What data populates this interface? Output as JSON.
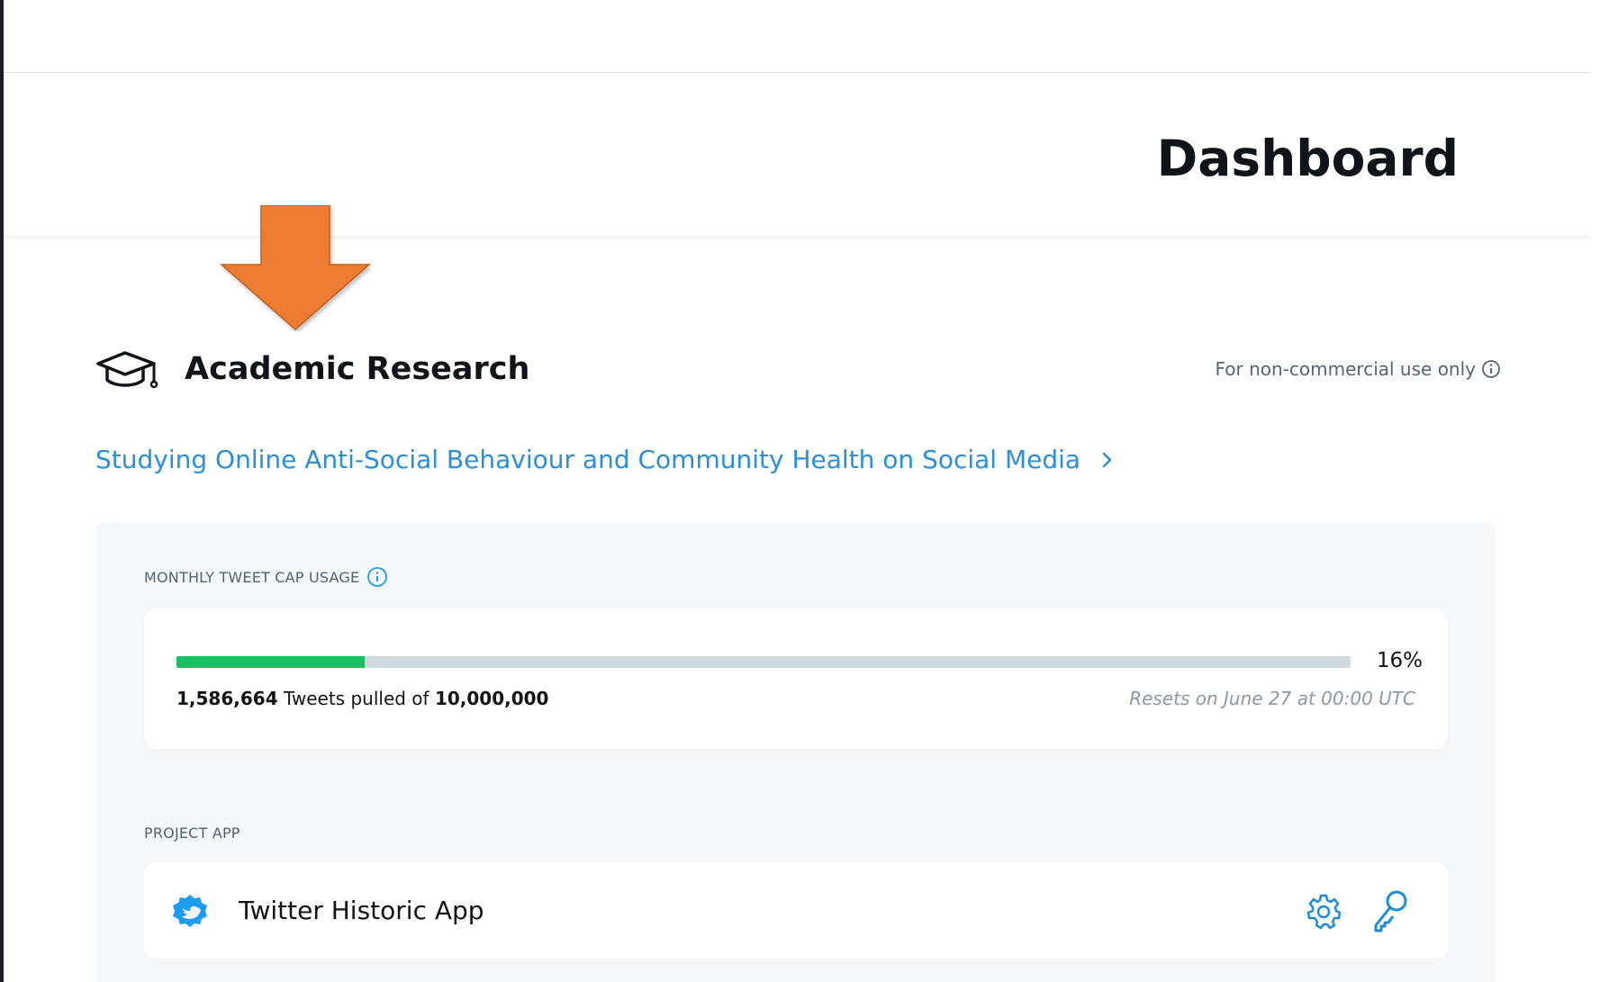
{
  "header": {
    "title": "Dashboard"
  },
  "product": {
    "icon": "graduation-cap-icon",
    "title": "Academic Research",
    "usage_note": "For non-commercial use only"
  },
  "project": {
    "link_label": "Studying Online Anti-Social Behaviour and Community Health on Social Media"
  },
  "tweet_cap": {
    "section_label": "MONTHLY TWEET CAP USAGE",
    "percent_label": "16%",
    "percent_value": 0.16,
    "pulled": "1,586,664",
    "pulled_text": "Tweets pulled of",
    "cap": "10,000,000",
    "reset_note": "Resets on June 27 at 00:00 UTC",
    "fill_color": "#17bf63",
    "track_color": "#cfd9de"
  },
  "project_app": {
    "section_label": "PROJECT APP",
    "app_name": "Twitter Historic App",
    "app_icon": "app-badge-icon",
    "actions": [
      "gear-icon",
      "key-icon"
    ]
  },
  "colors": {
    "link": "#2a8fd6",
    "annotation_arrow": "#ed7d31",
    "panel_bg": "#f5f8fa"
  }
}
